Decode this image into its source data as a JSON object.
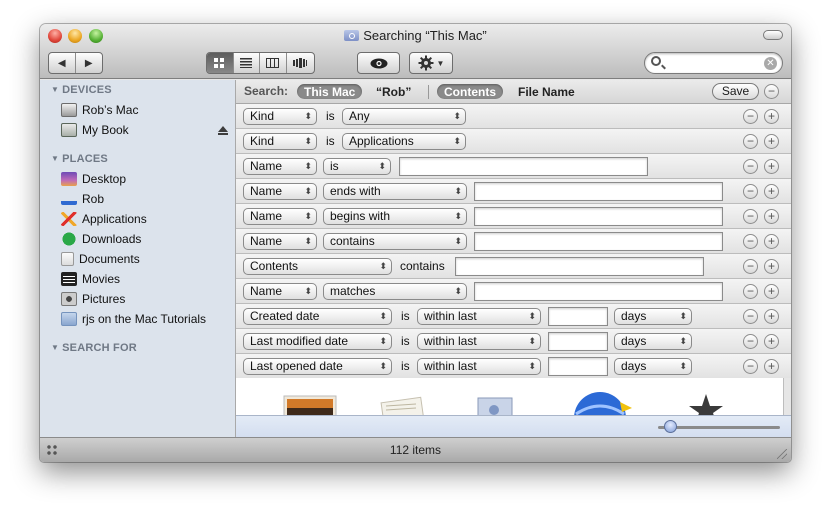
{
  "window": {
    "title": "Searching “This Mac”"
  },
  "toolbar": {
    "nav": [
      "◀",
      "▶"
    ],
    "views": [
      "icon-view",
      "list-view",
      "column-view",
      "coverflow-view"
    ],
    "quicklook_icon": "eye-icon",
    "action_icon": "gear-icon",
    "search_value": ""
  },
  "sidebar": {
    "sections": [
      {
        "heading": "DEVICES",
        "items": [
          {
            "label": "Rob’s Mac",
            "icon": "computer-icon"
          },
          {
            "label": "My Book",
            "icon": "external-drive-icon"
          }
        ]
      },
      {
        "heading": "PLACES",
        "items": [
          {
            "label": "Desktop",
            "icon": "desktop-icon"
          },
          {
            "label": "Rob",
            "icon": "home-icon"
          },
          {
            "label": "Applications",
            "icon": "applications-icon"
          },
          {
            "label": "Downloads",
            "icon": "downloads-icon"
          },
          {
            "label": "Documents",
            "icon": "documents-icon"
          },
          {
            "label": "Movies",
            "icon": "movies-icon"
          },
          {
            "label": "Pictures",
            "icon": "pictures-icon"
          },
          {
            "label": "rjs on the Mac Tutorials",
            "icon": "folder-icon"
          }
        ]
      },
      {
        "heading": "SEARCH FOR",
        "items": []
      }
    ]
  },
  "scope": {
    "label": "Search:",
    "this_mac": "This Mac",
    "rob": "“Rob”",
    "contents": "Contents",
    "file_name": "File Name",
    "save": "Save"
  },
  "criteria": [
    {
      "attr": "Kind",
      "op_text": "is",
      "value_popup": "Any"
    },
    {
      "attr": "Kind",
      "op_text": "is",
      "value_popup": "Applications"
    },
    {
      "attr": "Name",
      "op_popup": "is",
      "field": ""
    },
    {
      "attr": "Name",
      "op_popup": "ends with",
      "field": ""
    },
    {
      "attr": "Name",
      "op_popup": "begins with",
      "field": ""
    },
    {
      "attr": "Name",
      "op_popup": "contains",
      "field": ""
    },
    {
      "attr": "Contents",
      "op_text": "contains",
      "field": ""
    },
    {
      "attr": "Name",
      "op_popup": "matches",
      "field": ""
    },
    {
      "attr": "Created date",
      "op_text": "is",
      "op_popup": "within last",
      "field": "",
      "unit": "days"
    },
    {
      "attr": "Last modified date",
      "op_text": "is",
      "op_popup": "within last",
      "field": "",
      "unit": "days"
    },
    {
      "attr": "Last opened date",
      "op_text": "is",
      "op_popup": "within last",
      "field": "",
      "unit": "days"
    }
  ],
  "row_buttons": {
    "remove": "−",
    "add": "+"
  },
  "status": {
    "items": "112 items"
  }
}
